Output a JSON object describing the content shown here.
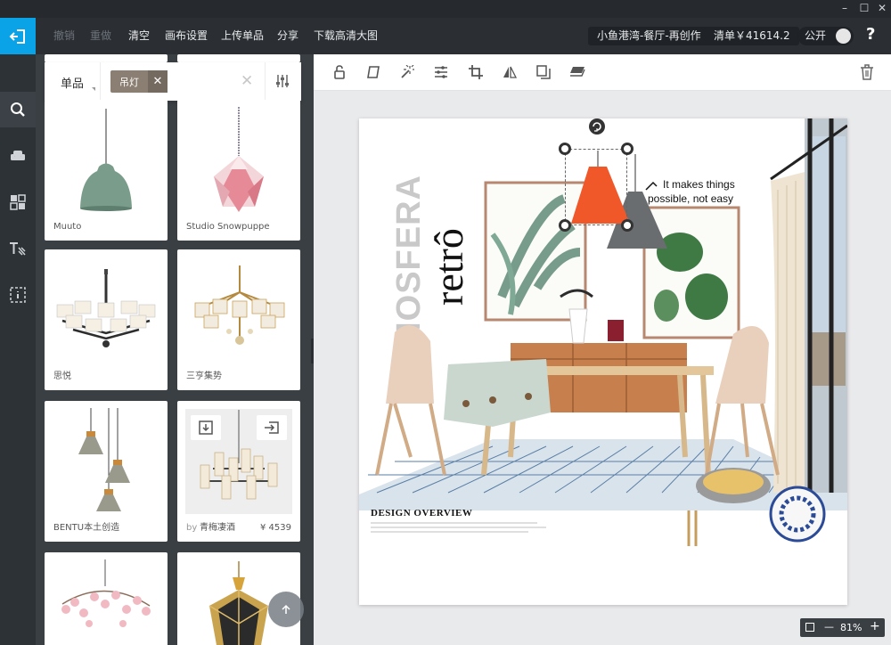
{
  "window": {
    "min": "–",
    "max": "☐",
    "close": "✕"
  },
  "toolbar": {
    "undo": "撤销",
    "redo": "重做",
    "clear": "清空",
    "canvas_settings": "画布设置",
    "upload_item": "上传单品",
    "share": "分享",
    "download_hd": "下载高清大图",
    "project_name": "小鱼港湾-餐厅-再创作",
    "list_total": "清单￥41614.2",
    "public_label": "公开",
    "help": "?"
  },
  "filter": {
    "category": "单品",
    "tag": "吊灯"
  },
  "products": [
    {
      "caption": "Muuto"
    },
    {
      "caption": "Studio Snowpuppe"
    },
    {
      "caption": "思悦"
    },
    {
      "caption": "三亨集势"
    },
    {
      "caption": "BENTU本土创造"
    },
    {
      "by": "by",
      "brand": "青梅凄酒",
      "price": "¥ 4539"
    }
  ],
  "board": {
    "wordmark": "MOSFERA",
    "script": "retrô",
    "quote_line1": "It makes things",
    "quote_line2": "possible, not easy",
    "overview_title": "DESIGN OVERVIEW"
  },
  "zoom": {
    "level": "81%",
    "minus": "—",
    "plus": "+"
  },
  "colors": {
    "accent": "#0aa3e8",
    "lamp_orange": "#f0582a"
  }
}
